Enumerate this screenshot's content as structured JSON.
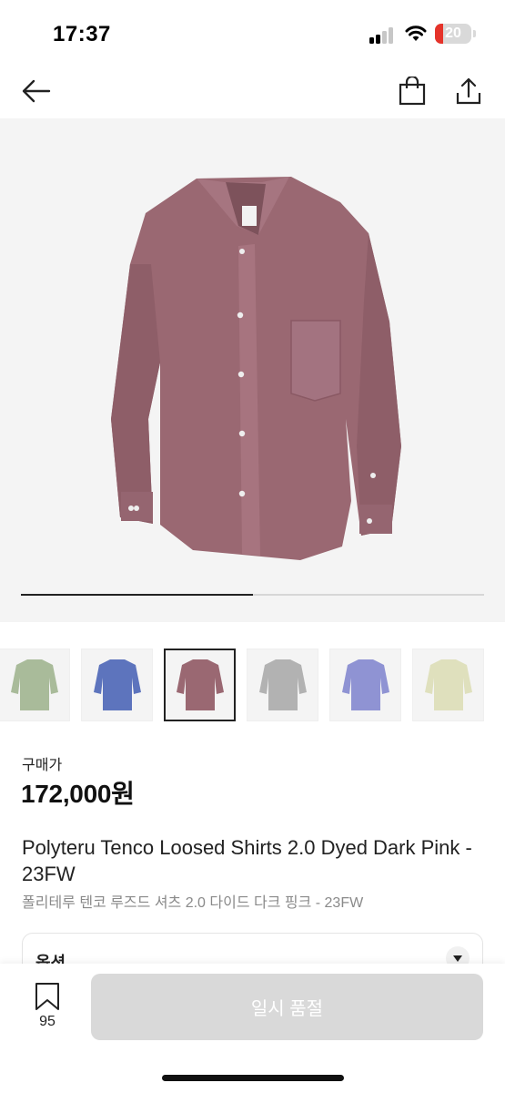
{
  "status_bar": {
    "time": "17:37",
    "battery_level": "20",
    "battery_color": "#e5332a"
  },
  "nav": {
    "back_icon": "arrow-left-icon",
    "bag_icon": "shopping-bag-icon",
    "share_icon": "share-icon"
  },
  "hero": {
    "image": "dark-pink-shirt",
    "shirt_color": "#9a6872",
    "progress_fraction": 0.5
  },
  "thumbnails": [
    {
      "color": "#a9bb9a",
      "selected": false
    },
    {
      "color": "#5d74bd",
      "selected": false
    },
    {
      "color": "#9a6872",
      "selected": true
    },
    {
      "color": "#b2b2b2",
      "selected": false
    },
    {
      "color": "#8f93d3",
      "selected": false
    },
    {
      "color": "#dfe0bd",
      "selected": false
    }
  ],
  "price": {
    "label": "구매가",
    "value": "172,000원"
  },
  "product": {
    "title_en": "Polyteru Tenco Loosed Shirts 2.0 Dyed Dark Pink - 23FW",
    "title_ko": "폴리테루 텐코 루즈드 셔츠 2.0 다이드 다크 핑크 - 23FW"
  },
  "option": {
    "label": "옵션"
  },
  "bottom_bar": {
    "wish_count": "95",
    "soldout_label": "일시 품절"
  }
}
